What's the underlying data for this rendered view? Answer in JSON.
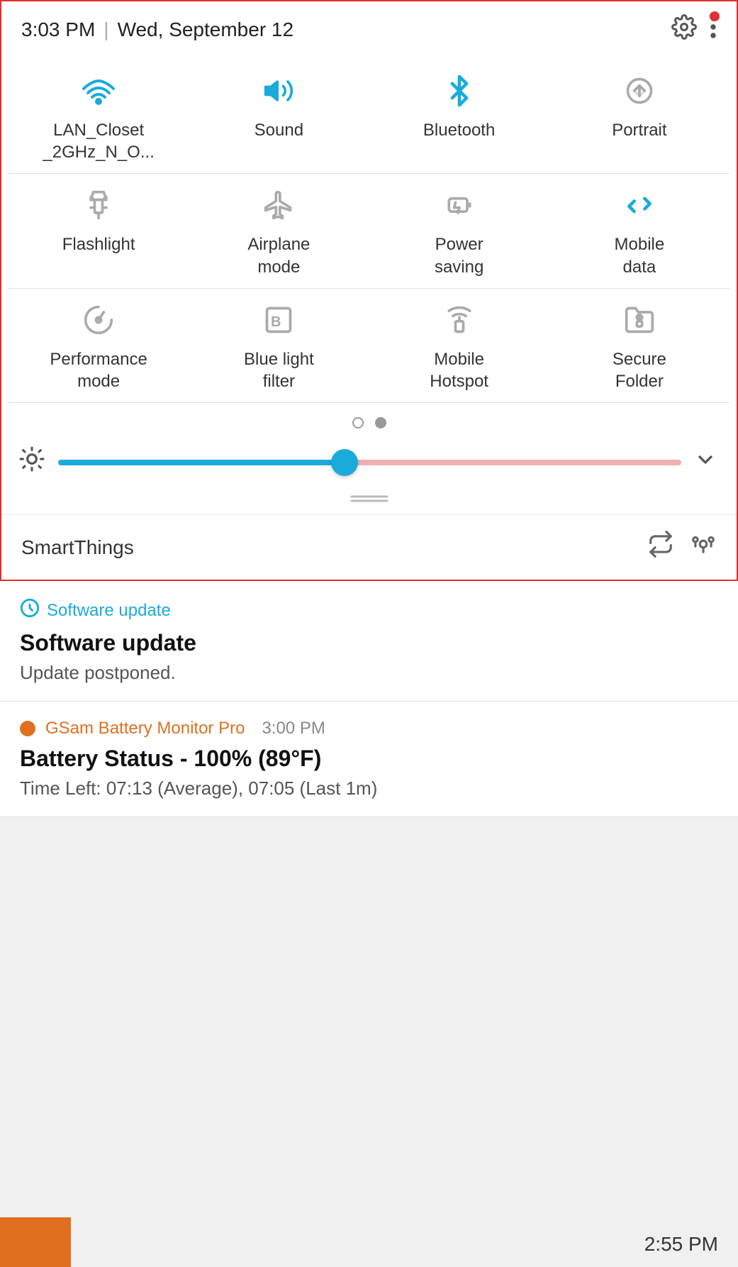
{
  "statusBar": {
    "time": "3:03 PM",
    "separator": "|",
    "date": "Wed, September 12"
  },
  "tiles": [
    {
      "id": "wifi",
      "label": "LAN_Closet\n_2GHz_N_O...",
      "labelLines": [
        "LAN_Closet",
        "_2GHz_N_O..."
      ],
      "active": true,
      "iconType": "wifi"
    },
    {
      "id": "sound",
      "label": "Sound",
      "labelLines": [
        "Sound"
      ],
      "active": true,
      "iconType": "sound"
    },
    {
      "id": "bluetooth",
      "label": "Bluetooth",
      "labelLines": [
        "Bluetooth"
      ],
      "active": true,
      "iconType": "bluetooth"
    },
    {
      "id": "portrait",
      "label": "Portrait",
      "labelLines": [
        "Portrait"
      ],
      "active": false,
      "iconType": "portrait"
    },
    {
      "id": "flashlight",
      "label": "Flashlight",
      "labelLines": [
        "Flashlight"
      ],
      "active": false,
      "iconType": "flashlight"
    },
    {
      "id": "airplane",
      "label": "Airplane\nmode",
      "labelLines": [
        "Airplane",
        "mode"
      ],
      "active": false,
      "iconType": "airplane"
    },
    {
      "id": "powersaving",
      "label": "Power\nsaving",
      "labelLines": [
        "Power",
        "saving"
      ],
      "active": false,
      "iconType": "powersaving"
    },
    {
      "id": "mobiledata",
      "label": "Mobile\ndata",
      "labelLines": [
        "Mobile",
        "data"
      ],
      "active": true,
      "iconType": "mobiledata"
    },
    {
      "id": "performance",
      "label": "Performance\nmode",
      "labelLines": [
        "Performance",
        "mode"
      ],
      "active": false,
      "iconType": "performance"
    },
    {
      "id": "bluelight",
      "label": "Blue light\nfilter",
      "labelLines": [
        "Blue light",
        "filter"
      ],
      "active": false,
      "iconType": "bluelight"
    },
    {
      "id": "hotspot",
      "label": "Mobile\nHotspot",
      "labelLines": [
        "Mobile",
        "Hotspot"
      ],
      "active": false,
      "iconType": "hotspot"
    },
    {
      "id": "securefolder",
      "label": "Secure\nFolder",
      "labelLines": [
        "Secure",
        "Folder"
      ],
      "active": false,
      "iconType": "securefolder"
    }
  ],
  "brightness": {
    "value": 48
  },
  "smartthings": {
    "label": "SmartThings"
  },
  "notifications": [
    {
      "appName": "Software update",
      "title": "Software update",
      "body": "Update postponed.",
      "iconColor": "#1aabdb"
    },
    {
      "appName": "GSam Battery Monitor Pro",
      "time": "3:00 PM",
      "title": "Battery Status - 100% (89°F)",
      "body": "Time Left: 07:13 (Average), 07:05 (Last 1m)",
      "iconColor": "#e07020"
    }
  ],
  "bottomBar": {
    "time": "2:55 PM"
  }
}
